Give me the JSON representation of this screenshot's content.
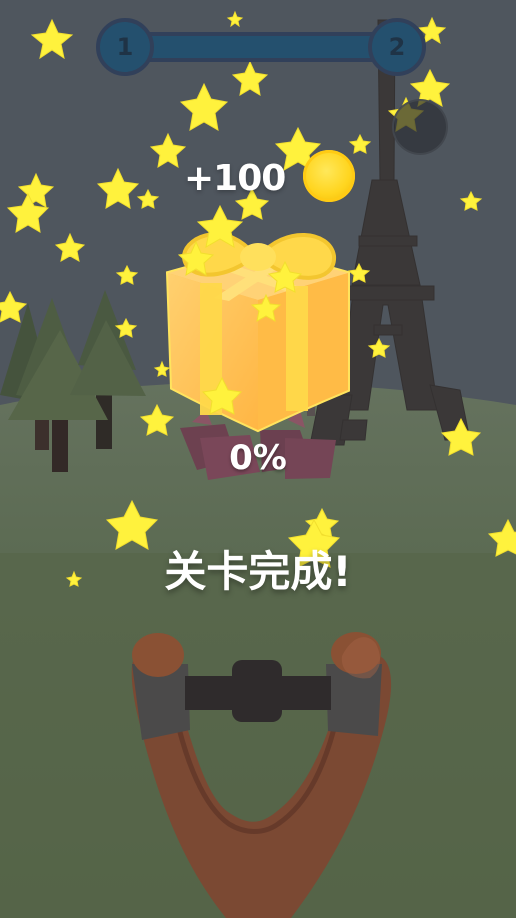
{
  "level": {
    "current": "1",
    "next": "2"
  },
  "reward": {
    "amount": "+100",
    "currency_icon": "coin-icon"
  },
  "progress": {
    "percent_text": "0%"
  },
  "message": {
    "level_complete": "关卡完成!"
  },
  "icons": {
    "settings": "gear-icon"
  },
  "colors": {
    "sky": "#4e555c",
    "ground_dark": "#556449",
    "ground_light": "#65725e",
    "gift": "#ffbf50",
    "ribbon": "#ffd84a",
    "star": "#fff13b",
    "slingshot_wood": "#7d4a34",
    "progress_blue": "#24506e"
  }
}
